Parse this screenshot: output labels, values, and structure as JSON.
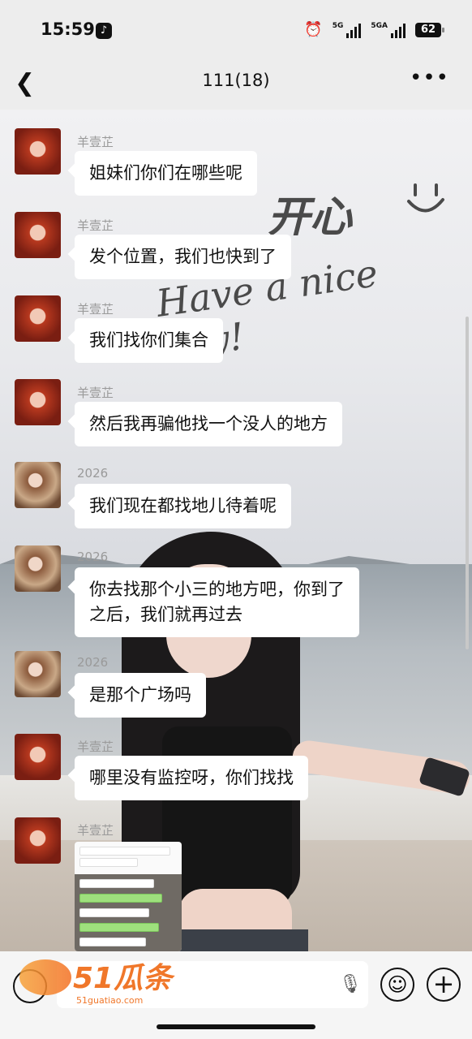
{
  "status_bar": {
    "time": "15:59",
    "app_icon": "tiktok-icon",
    "alarm_icon": "alarm-icon",
    "signal1_label": "5G",
    "signal2_label": "5GA",
    "battery": "62"
  },
  "nav": {
    "title": "111(18)",
    "back_icon": "chevron-left-icon",
    "more_icon": "more-icon"
  },
  "overlay": {
    "text1": "开心",
    "text2": "Have a nice day!"
  },
  "messages": [
    {
      "sender": "羊壹芷",
      "text": "姐妹们你们在哪些呢",
      "avatar": "red"
    },
    {
      "sender": "羊壹芷",
      "text": "发个位置，我们也快到了",
      "avatar": "red"
    },
    {
      "sender": "羊壹芷",
      "text": "我们找你们集合",
      "avatar": "red"
    },
    {
      "sender": "羊壹芷",
      "text": "然后我再骗他找一个没人的地方",
      "avatar": "red"
    },
    {
      "sender": "2026",
      "text": "我们现在都找地儿待着呢",
      "avatar": "cat"
    },
    {
      "sender": "2026",
      "text_line1": "你去找那个小三的地方吧，你到了",
      "text_line2": "之后，我们就再过去",
      "avatar": "cat"
    },
    {
      "sender": "2026",
      "text": "是那个广场吗",
      "avatar": "cat"
    },
    {
      "sender": "羊壹芷",
      "text": "哪里没有监控呀，你们找找",
      "avatar": "red"
    },
    {
      "sender": "羊壹芷",
      "image": "screenshot-image",
      "avatar": "red"
    }
  ],
  "input_bar": {
    "watermark": "51瓜条",
    "watermark_url": "51guatiao.com"
  }
}
